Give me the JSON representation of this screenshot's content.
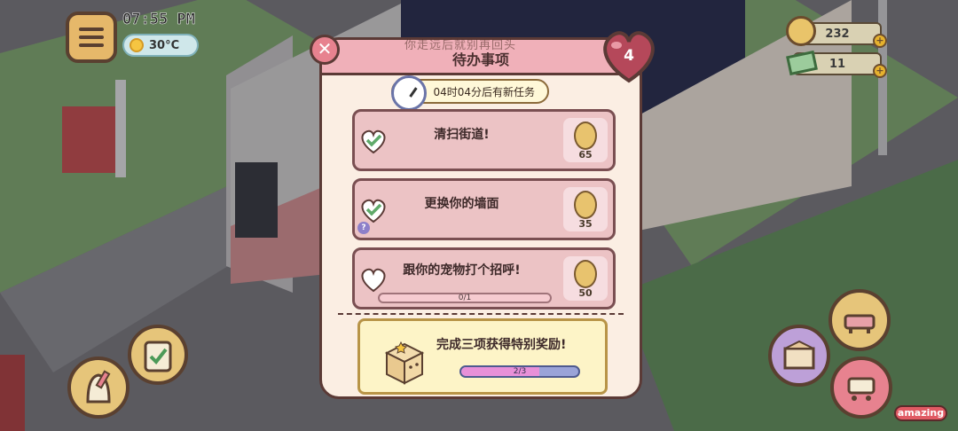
{
  "hud": {
    "time": "07:55 PM",
    "temperature": "30°C",
    "coins": "232",
    "cash": "11"
  },
  "overlay_note": "你走远后就别再回头",
  "dialog": {
    "title": "待办事项",
    "hearts": "4",
    "timer_text": "04时04分后有新任务",
    "tasks": [
      {
        "title": "清扫街道!",
        "reward": "65",
        "completed": true,
        "has_help": false
      },
      {
        "title": "更换你的墙面",
        "reward": "35",
        "completed": true,
        "has_help": true,
        "help_icon": "?"
      },
      {
        "title": "跟你的宠物打个招呼!",
        "reward": "50",
        "completed": false,
        "progress_text": "0/1",
        "progress": 0.0
      }
    ],
    "bonus": {
      "text": "完成三项获得特别奖励!",
      "progress_text": "2/3",
      "progress": 0.667
    }
  },
  "buttons": {
    "amazing_label": "amazing"
  },
  "colors": {
    "accent": "#f0b0b9",
    "task_bg": "#ecc3c5",
    "bonus_bg": "#fdf4c7",
    "complete_check": "#5faa6a"
  }
}
